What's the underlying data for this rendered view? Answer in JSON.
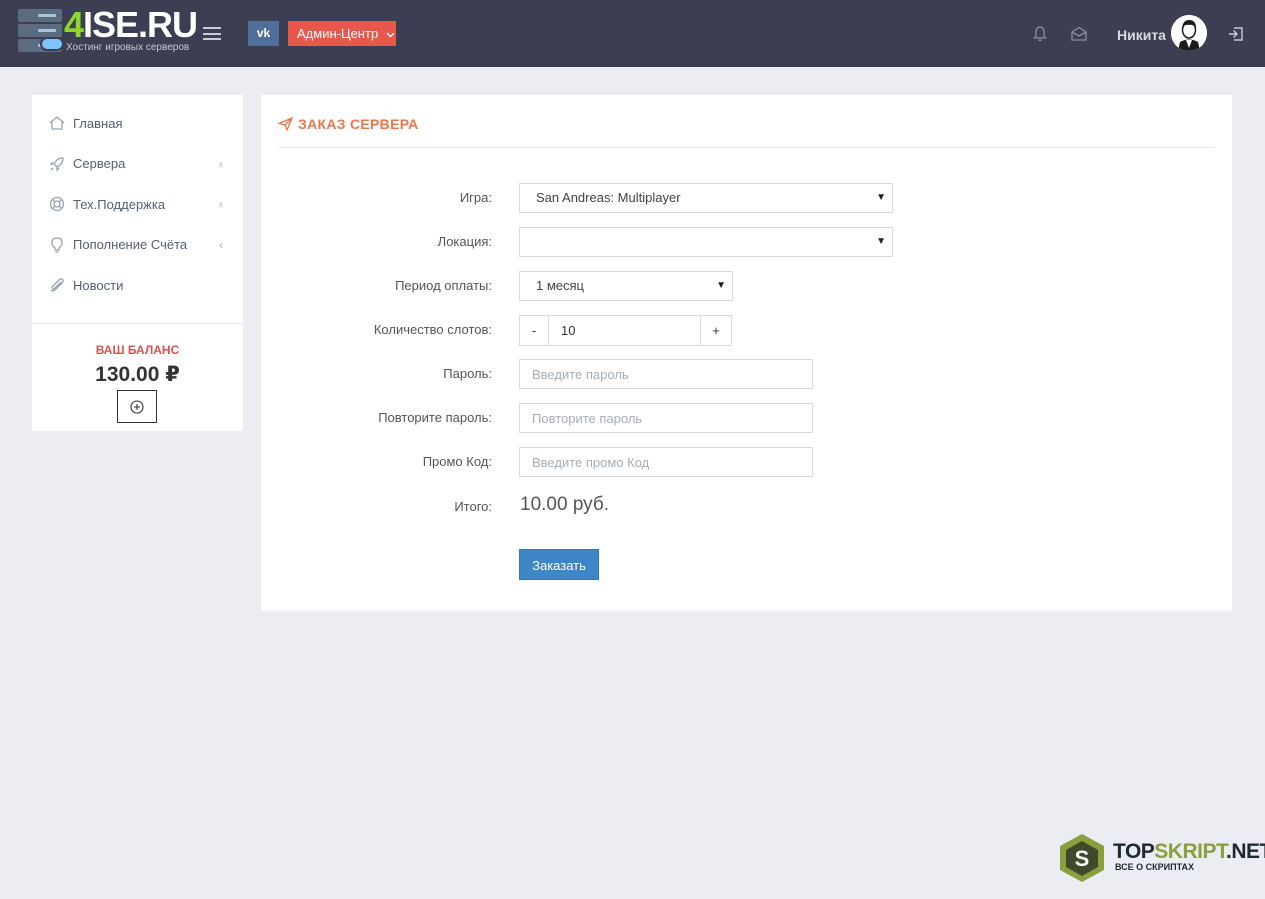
{
  "header": {
    "logo_main": "ISE.RU",
    "logo_digit": "4",
    "logo_subtitle": "Хостинг игровых серверов",
    "vk_label": "vk",
    "admin_label": "Админ-Центр",
    "user_name": "Никита",
    "icons": [
      "menu-icon",
      "bell-icon",
      "mail-icon",
      "logout-icon"
    ]
  },
  "sidebar": {
    "items": [
      {
        "label": "Главная",
        "icon": "home-icon",
        "has_arrow": false
      },
      {
        "label": "Сервера",
        "icon": "rocket-icon",
        "has_arrow": true
      },
      {
        "label": "Тех.Поддержка",
        "icon": "lifebuoy-icon",
        "has_arrow": true
      },
      {
        "label": "Пополнение Счёта",
        "icon": "bulb-icon",
        "has_arrow": true
      },
      {
        "label": "Новости",
        "icon": "paperclip-icon",
        "has_arrow": false
      }
    ],
    "arrow_glyph": "‹",
    "balance_title": "ВАШ БАЛАНС",
    "balance_value": "130.00 ₽"
  },
  "panel": {
    "title": "ЗАКАЗ СЕРВЕРА",
    "form": {
      "game_label": "Игра:",
      "game_value": "San Andreas: Multiplayer",
      "location_label": "Локация:",
      "location_value": "",
      "period_label": "Период оплаты:",
      "period_value": "1 месяц",
      "slots_label": "Количество слотов:",
      "slots_minus": "-",
      "slots_value": "10",
      "slots_plus": "+",
      "password_label": "Пароль:",
      "password_placeholder": "Введите пароль",
      "password_repeat_label": "Повторите пароль:",
      "password_repeat_placeholder": "Повторите пароль",
      "promo_label": "Промо Код:",
      "promo_placeholder": "Введите промо Код",
      "total_label": "Итого:",
      "total_value": "10.00 руб.",
      "submit_label": "Заказать",
      "caret": "▼"
    }
  },
  "watermark": {
    "title_top": "TOP",
    "title_mid": "SKRIPT",
    "title_end": ".NET",
    "subtitle": "ВСЕ О СКРИПТАХ",
    "letter": "S"
  },
  "colors": {
    "header_bg": "#3b3f51",
    "accent_orange": "#e9774d",
    "admin_red": "#e7574b",
    "vk_blue": "#4f6e99",
    "button_blue": "#3d87c8",
    "balance_red": "#d9534f",
    "logo_green": "#8ed629",
    "page_bg": "#ebedf3"
  }
}
